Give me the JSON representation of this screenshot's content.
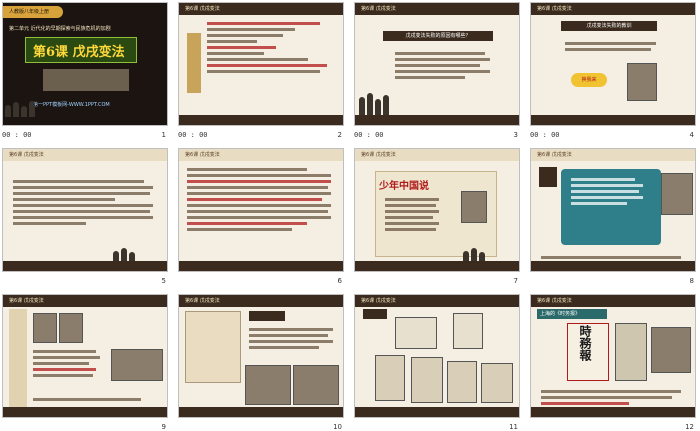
{
  "slides": [
    {
      "num": "1",
      "time": "00 : 00",
      "header": "人教版八年级上册",
      "subtitle": "第二单元 近代化的早期探索与民族危机的加剧",
      "title": "第6课 戊戌变法",
      "site": "第一PPT模板网-WWW.1PPT.COM"
    },
    {
      "num": "2",
      "time": "00 : 00",
      "header": "第6课 戊戌变法"
    },
    {
      "num": "3",
      "time": "00 : 00",
      "header": "第6课 戊戌变法",
      "question": "戊戌变法失败的原因有哪些？"
    },
    {
      "num": "4",
      "time": "00 : 00",
      "header": "第6课 戊戌变法",
      "question": "戊戌变法失败的教训",
      "answer": "换我来"
    },
    {
      "num": "5",
      "time": "",
      "header": "第6课 戊戌变法"
    },
    {
      "num": "6",
      "time": "",
      "header": "第6课 戊戌变法"
    },
    {
      "num": "7",
      "time": "",
      "header": "第6课 戊戌变法",
      "poem_title": "少年中国说"
    },
    {
      "num": "8",
      "time": "",
      "header": "第6课 戊戌变法"
    },
    {
      "num": "9",
      "time": "",
      "header": "第6课 戊戌变法"
    },
    {
      "num": "10",
      "time": "",
      "header": "第6课 戊戌变法"
    },
    {
      "num": "11",
      "time": "",
      "header": "第6课 戊戌变法"
    },
    {
      "num": "12",
      "time": "",
      "header": "第6课 戊戌变法",
      "slide_title": "上海的《时务报》",
      "paper_name": "時務報"
    }
  ],
  "colors": {
    "dark": "#3b2b1e",
    "paper": "#f4efe2",
    "red": "#b11a1a",
    "gold": "#ffd83a"
  }
}
